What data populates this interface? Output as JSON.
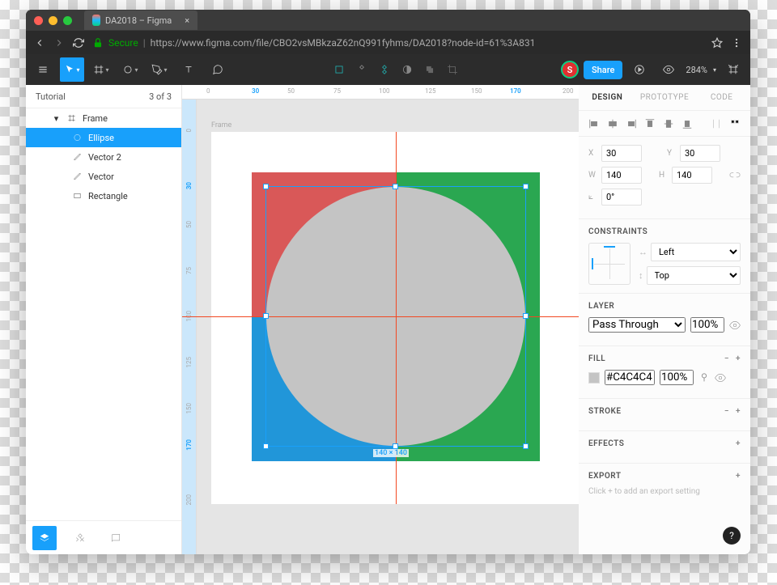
{
  "window": {
    "tab_title": "DA2018 – Figma",
    "url_prefix": "Secure",
    "url": "https://www.figma.com/file/CBO2vsMBkzaZ62nQ991fyhms/DA2018?node-id=61%3A831"
  },
  "toolbar": {
    "share_label": "Share",
    "zoom": "284%",
    "avatar": "S"
  },
  "left": {
    "title": "Tutorial",
    "page_indicator": "3 of 3",
    "layers": {
      "frame": "Frame",
      "ellipse": "Ellipse",
      "vector2": "Vector 2",
      "vector": "Vector",
      "rectangle": "Rectangle"
    }
  },
  "ruler_h": {
    "t0": "0",
    "t30": "30",
    "t50": "50",
    "t75": "75",
    "t100": "100",
    "t125": "125",
    "t150": "150",
    "t170": "170",
    "t200": "200"
  },
  "ruler_v": {
    "t0": "0",
    "t30": "30",
    "t50": "50",
    "t75": "75",
    "t100": "100",
    "t125": "125",
    "t150": "150",
    "t170": "170",
    "t200": "200"
  },
  "canvas": {
    "frame_label": "Frame",
    "dim_w": "140",
    "dim_h": "140"
  },
  "right": {
    "tabs": {
      "design": "DESIGN",
      "prototype": "PROTOTYPE",
      "code": "CODE"
    },
    "position": {
      "x_label": "X",
      "x": "30",
      "y_label": "Y",
      "y": "30",
      "w_label": "W",
      "w": "140",
      "h_label": "H",
      "h": "140",
      "r_label": "⟀",
      "r": "0°"
    },
    "constraints": {
      "title": "CONSTRAINTS",
      "h": "Left",
      "v": "Top"
    },
    "layer": {
      "title": "LAYER",
      "blend": "Pass Through",
      "opacity": "100%"
    },
    "fill": {
      "title": "FILL",
      "hex": "#C4C4C4",
      "opacity": "100%"
    },
    "stroke": {
      "title": "STROKE"
    },
    "effects": {
      "title": "EFFECTS"
    },
    "export": {
      "title": "EXPORT",
      "hint": "Click + to add an export setting"
    }
  },
  "help": "?"
}
